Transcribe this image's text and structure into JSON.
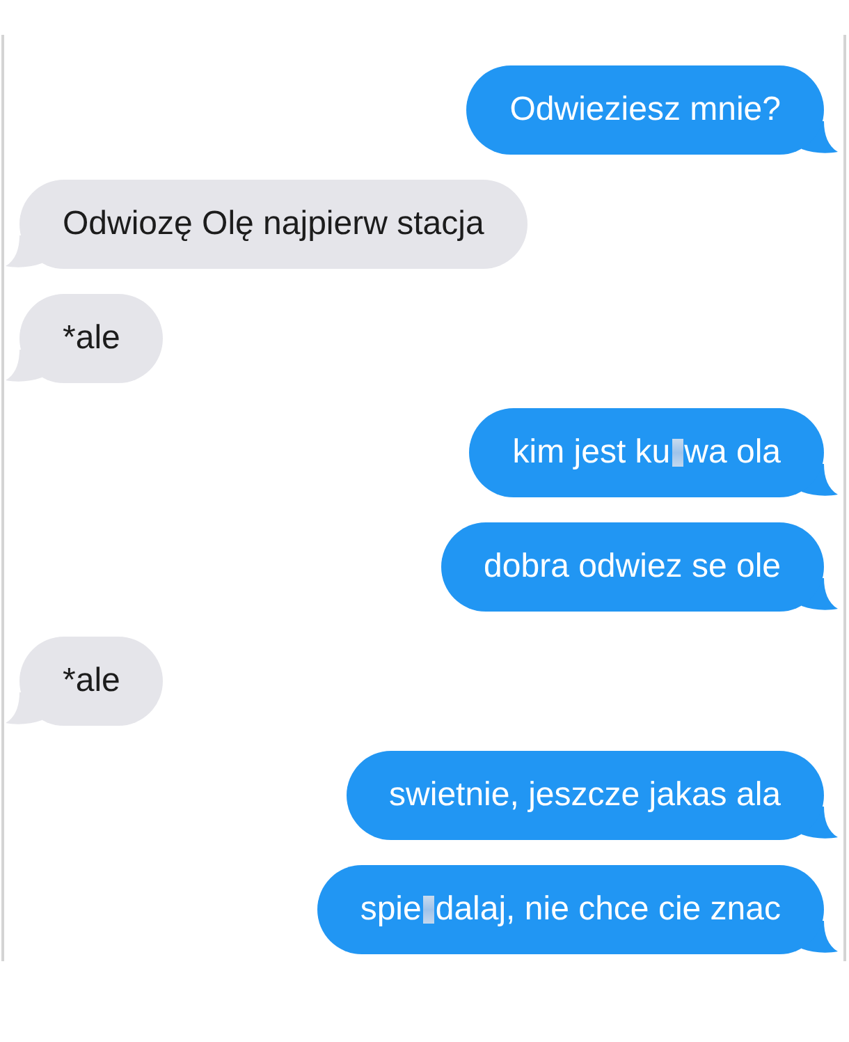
{
  "messages": [
    {
      "kind": "sent",
      "segments": [
        {
          "kind": "text",
          "text": "Odwieziesz mnie?"
        }
      ]
    },
    {
      "kind": "received",
      "segments": [
        {
          "kind": "text",
          "text": "Odwiozę Olę najpierw stacja"
        }
      ]
    },
    {
      "kind": "received",
      "segments": [
        {
          "kind": "text",
          "text": "*ale"
        }
      ]
    },
    {
      "kind": "sent",
      "segments": [
        {
          "kind": "text",
          "text": "kim jest ku"
        },
        {
          "kind": "censor"
        },
        {
          "kind": "text",
          "text": "wa ola"
        }
      ]
    },
    {
      "kind": "sent",
      "segments": [
        {
          "kind": "text",
          "text": "dobra odwiez se ole"
        }
      ]
    },
    {
      "kind": "received",
      "segments": [
        {
          "kind": "text",
          "text": "*ale"
        }
      ]
    },
    {
      "kind": "sent",
      "segments": [
        {
          "kind": "text",
          "text": "swietnie, jeszcze jakas ala"
        }
      ]
    },
    {
      "kind": "sent",
      "segments": [
        {
          "kind": "text",
          "text": "spie"
        },
        {
          "kind": "censor"
        },
        {
          "kind": "text",
          "text": "dalaj, nie chce cie znac"
        }
      ]
    }
  ]
}
